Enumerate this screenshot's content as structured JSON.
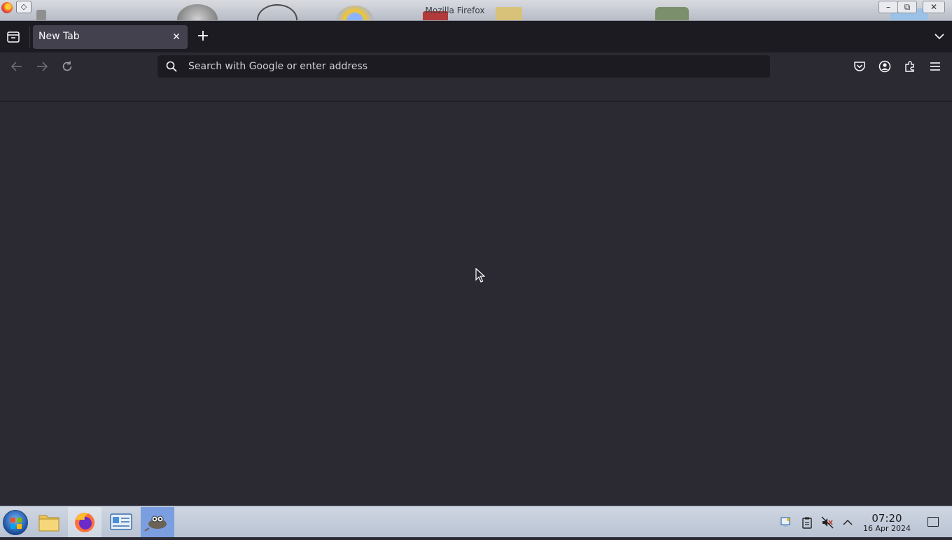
{
  "window": {
    "title": "Mozilla Firefox",
    "pin_glyph": "◇",
    "minimize_glyph": "–",
    "restore_glyph": "⧉",
    "close_glyph": "✕"
  },
  "tabs": {
    "items": [
      {
        "label": "New Tab",
        "active": true
      }
    ],
    "close_glyph": "✕",
    "new_tab_glyph": "+"
  },
  "navbar": {
    "back_icon": "arrow-left-icon",
    "forward_icon": "arrow-right-icon",
    "reload_icon": "reload-icon",
    "url_value": "",
    "url_placeholder": "Search with Google or enter address",
    "toolbar_icons": [
      "pocket-icon",
      "account-icon",
      "extensions-icon",
      "menu-icon"
    ]
  },
  "taskbar": {
    "apps": [
      "file-manager-icon",
      "firefox-icon",
      "control-panel-icon",
      "gimp-icon"
    ],
    "tray_icons": [
      "network-icon",
      "clipboard-icon",
      "volume-muted-icon",
      "chevron-up-icon"
    ],
    "clock": {
      "time": "07:20",
      "date": "16 Apr 2024"
    }
  },
  "colors": {
    "tabstrip_bg": "#1c1b22",
    "toolbar_bg": "#2b2a33",
    "active_tab_bg": "#42414d",
    "text": "#fbfbfe"
  }
}
